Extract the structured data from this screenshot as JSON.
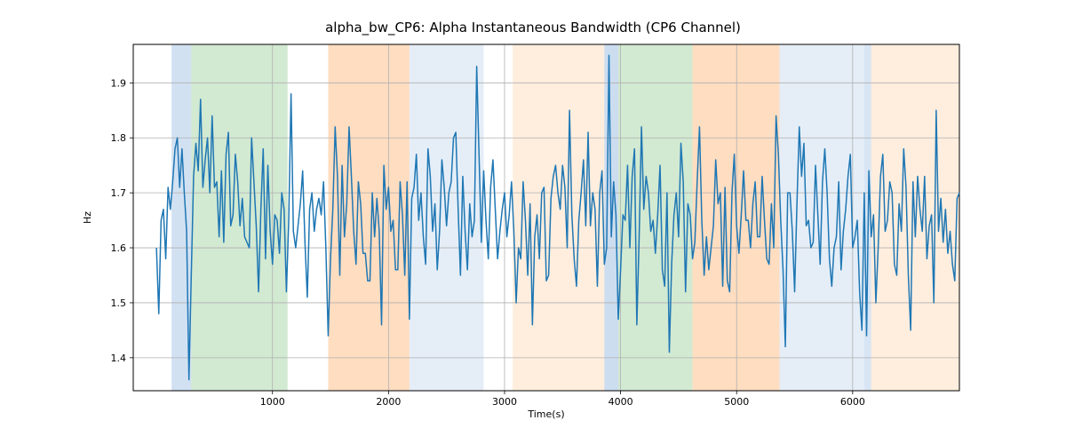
{
  "chart_data": {
    "type": "line",
    "title": "alpha_bw_CP6: Alpha Instantaneous Bandwidth (CP6 Channel)",
    "xlabel": "Time(s)",
    "ylabel": "Hz",
    "xlim": [
      -200,
      6920
    ],
    "ylim": [
      1.34,
      1.97
    ],
    "xticks": [
      1000,
      2000,
      3000,
      4000,
      5000,
      6000
    ],
    "yticks": [
      1.4,
      1.5,
      1.6,
      1.7,
      1.8,
      1.9
    ],
    "xtick_labels": [
      "1000",
      "2000",
      "3000",
      "4000",
      "5000",
      "6000"
    ],
    "ytick_labels": [
      "1.4",
      "1.5",
      "1.6",
      "1.7",
      "1.8",
      "1.9"
    ],
    "bands": [
      {
        "x0": 130,
        "x1": 300,
        "color": "#7fa9d9",
        "alpha": 0.35
      },
      {
        "x0": 300,
        "x1": 1130,
        "color": "#7fbf7f",
        "alpha": 0.35
      },
      {
        "x0": 1480,
        "x1": 2180,
        "color": "#ff9e4a",
        "alpha": 0.35
      },
      {
        "x0": 2180,
        "x1": 2820,
        "color": "#7fa9d9",
        "alpha": 0.2
      },
      {
        "x0": 3070,
        "x1": 3860,
        "color": "#ff9e4a",
        "alpha": 0.18
      },
      {
        "x0": 3860,
        "x1": 3980,
        "color": "#7fa9d9",
        "alpha": 0.4
      },
      {
        "x0": 3980,
        "x1": 4620,
        "color": "#7fbf7f",
        "alpha": 0.35
      },
      {
        "x0": 4620,
        "x1": 5370,
        "color": "#ff9e4a",
        "alpha": 0.35
      },
      {
        "x0": 5370,
        "x1": 6100,
        "color": "#7fa9d9",
        "alpha": 0.2
      },
      {
        "x0": 6100,
        "x1": 6160,
        "color": "#7fa9d9",
        "alpha": 0.3
      },
      {
        "x0": 6160,
        "x1": 6920,
        "color": "#ff9e4a",
        "alpha": 0.18
      }
    ],
    "series": [
      {
        "name": "alpha_bw_CP6",
        "color": "#1f77b4",
        "x_start": 0,
        "x_step": 20,
        "values": [
          1.6,
          1.48,
          1.65,
          1.67,
          1.58,
          1.71,
          1.67,
          1.72,
          1.78,
          1.8,
          1.71,
          1.78,
          1.7,
          1.63,
          1.36,
          1.55,
          1.73,
          1.79,
          1.74,
          1.87,
          1.71,
          1.76,
          1.8,
          1.7,
          1.84,
          1.71,
          1.72,
          1.62,
          1.74,
          1.61,
          1.77,
          1.81,
          1.64,
          1.66,
          1.77,
          1.72,
          1.64,
          1.69,
          1.62,
          1.61,
          1.6,
          1.8,
          1.72,
          1.64,
          1.52,
          1.67,
          1.78,
          1.58,
          1.75,
          1.63,
          1.57,
          1.66,
          1.65,
          1.59,
          1.7,
          1.67,
          1.52,
          1.65,
          1.88,
          1.63,
          1.6,
          1.64,
          1.68,
          1.74,
          1.61,
          1.51,
          1.67,
          1.7,
          1.63,
          1.67,
          1.69,
          1.66,
          1.72,
          1.6,
          1.44,
          1.58,
          1.67,
          1.82,
          1.73,
          1.55,
          1.75,
          1.62,
          1.68,
          1.82,
          1.73,
          1.63,
          1.57,
          1.72,
          1.68,
          1.59,
          1.59,
          1.54,
          1.54,
          1.7,
          1.62,
          1.69,
          1.63,
          1.46,
          1.75,
          1.67,
          1.71,
          1.63,
          1.65,
          1.56,
          1.56,
          1.72,
          1.66,
          1.55,
          1.72,
          1.47,
          1.69,
          1.71,
          1.77,
          1.65,
          1.7,
          1.62,
          1.57,
          1.78,
          1.73,
          1.63,
          1.68,
          1.56,
          1.63,
          1.76,
          1.71,
          1.64,
          1.7,
          1.72,
          1.8,
          1.81,
          1.67,
          1.55,
          1.73,
          1.63,
          1.56,
          1.68,
          1.62,
          1.65,
          1.93,
          1.77,
          1.61,
          1.74,
          1.65,
          1.58,
          1.71,
          1.76,
          1.67,
          1.58,
          1.63,
          1.67,
          1.7,
          1.62,
          1.66,
          1.72,
          1.63,
          1.5,
          1.6,
          1.58,
          1.72,
          1.65,
          1.55,
          1.68,
          1.46,
          1.62,
          1.66,
          1.58,
          1.7,
          1.71,
          1.54,
          1.55,
          1.69,
          1.73,
          1.75,
          1.7,
          1.67,
          1.75,
          1.71,
          1.6,
          1.85,
          1.66,
          1.58,
          1.53,
          1.65,
          1.7,
          1.76,
          1.64,
          1.81,
          1.64,
          1.7,
          1.67,
          1.53,
          1.7,
          1.74,
          1.57,
          1.6,
          1.95,
          1.62,
          1.72,
          1.66,
          1.47,
          1.56,
          1.66,
          1.65,
          1.75,
          1.6,
          1.73,
          1.78,
          1.46,
          1.62,
          1.82,
          1.67,
          1.73,
          1.7,
          1.63,
          1.65,
          1.59,
          1.66,
          1.75,
          1.56,
          1.53,
          1.7,
          1.41,
          1.57,
          1.66,
          1.7,
          1.62,
          1.79,
          1.72,
          1.52,
          1.68,
          1.66,
          1.58,
          1.61,
          1.72,
          1.82,
          1.65,
          1.55,
          1.62,
          1.56,
          1.6,
          1.64,
          1.76,
          1.68,
          1.7,
          1.53,
          1.71,
          1.54,
          1.52,
          1.7,
          1.77,
          1.64,
          1.59,
          1.66,
          1.74,
          1.65,
          1.65,
          1.6,
          1.68,
          1.72,
          1.62,
          1.62,
          1.73,
          1.65,
          1.58,
          1.57,
          1.68,
          1.6,
          1.84,
          1.77,
          1.65,
          1.56,
          1.42,
          1.7,
          1.7,
          1.63,
          1.52,
          1.68,
          1.82,
          1.73,
          1.79,
          1.64,
          1.65,
          1.6,
          1.61,
          1.75,
          1.66,
          1.57,
          1.72,
          1.78,
          1.7,
          1.58,
          1.53,
          1.6,
          1.62,
          1.72,
          1.56,
          1.63,
          1.67,
          1.73,
          1.77,
          1.6,
          1.62,
          1.65,
          1.52,
          1.45,
          1.7,
          1.44,
          1.74,
          1.62,
          1.66,
          1.5,
          1.6,
          1.73,
          1.77,
          1.63,
          1.65,
          1.72,
          1.7,
          1.57,
          1.55,
          1.68,
          1.63,
          1.78,
          1.71,
          1.55,
          1.45,
          1.72,
          1.62,
          1.73,
          1.67,
          1.63,
          1.73,
          1.58,
          1.64,
          1.66,
          1.5,
          1.85,
          1.63,
          1.69,
          1.61,
          1.67,
          1.59,
          1.63,
          1.57,
          1.54,
          1.69,
          1.7
        ]
      }
    ]
  }
}
